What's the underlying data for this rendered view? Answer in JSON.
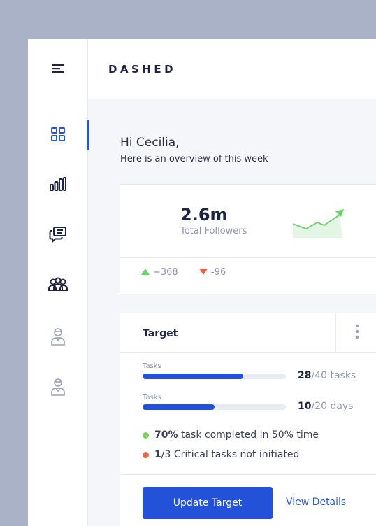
{
  "app": {
    "brand": "DASHED"
  },
  "colors": {
    "accent": "#2352D8",
    "positive": "#69D36A",
    "negative": "#F05A3C",
    "success_dot": "#7ED35E",
    "alert_dot": "#E8664C"
  },
  "sidebar": {
    "items": [
      {
        "icon": "dashboard-grid-icon",
        "active": true
      },
      {
        "icon": "bar-chart-icon",
        "active": false
      },
      {
        "icon": "chat-icon",
        "active": false
      },
      {
        "icon": "users-group-icon",
        "active": false
      },
      {
        "icon": "user-icon",
        "active": false
      },
      {
        "icon": "user-icon",
        "active": false
      }
    ]
  },
  "greeting": {
    "title": "Hi Cecilia,",
    "subtitle": "Here is an overview of this week"
  },
  "followers": {
    "value": "2.6m",
    "label": "Total Followers",
    "up_delta": "+368",
    "down_delta": "-96"
  },
  "target": {
    "title": "Target",
    "metrics": [
      {
        "label": "Tasks",
        "current": "28",
        "suffix": "/40 tasks",
        "progress": 0.7
      },
      {
        "label": "Tasks",
        "current": "10",
        "suffix": "/20 days",
        "progress": 0.5
      }
    ],
    "notes": [
      {
        "bold": "70%",
        "text": " task completed in 50% time"
      },
      {
        "bold": "1",
        "text": "/3 Critical tasks not initiated"
      }
    ],
    "primary_button": "Update Target",
    "link": "View Details"
  }
}
